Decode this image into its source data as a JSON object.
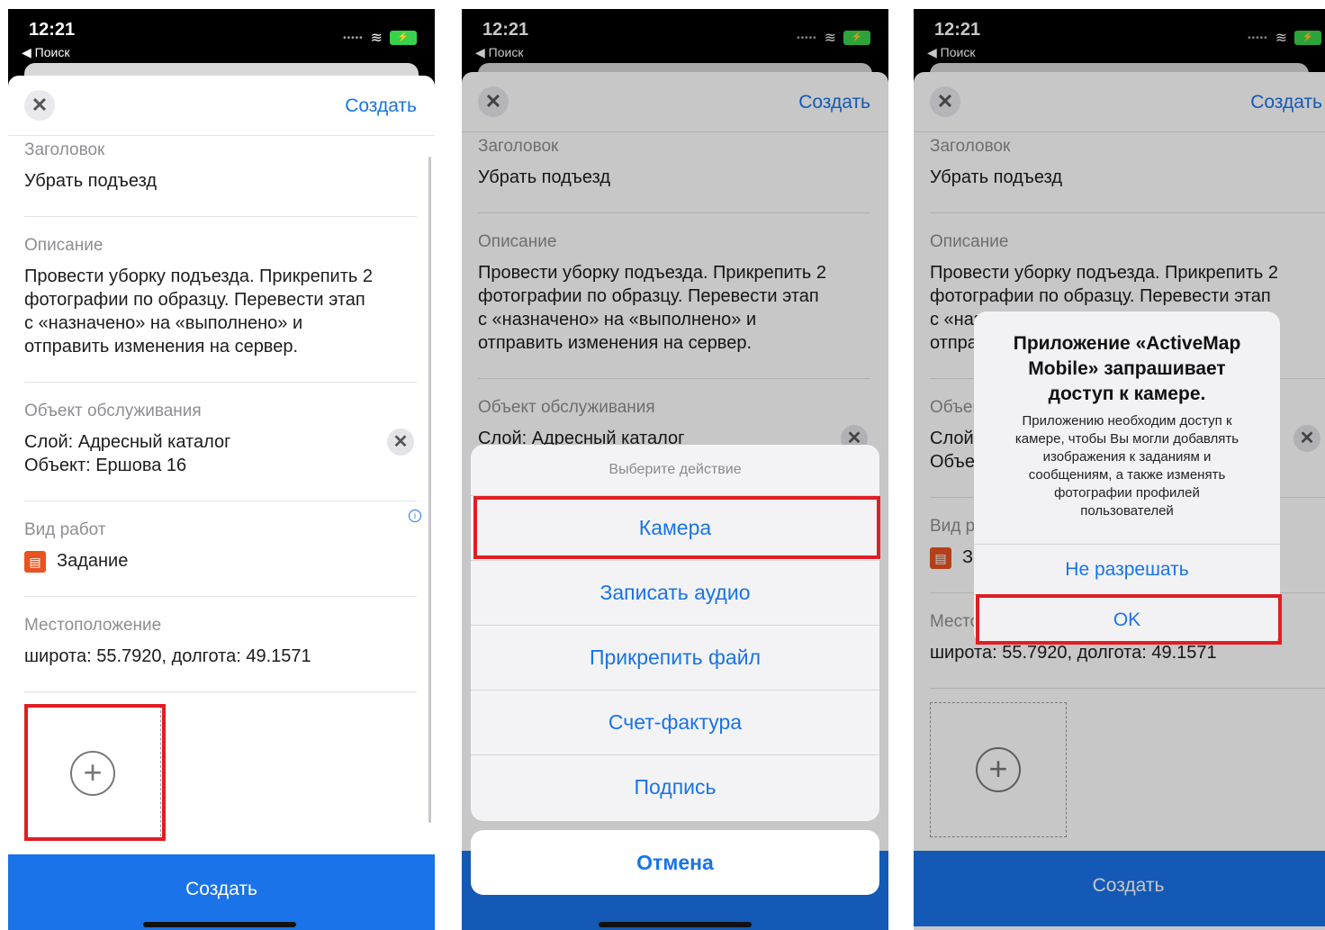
{
  "status": {
    "time": "12:21",
    "back_label": "◀ Поиск"
  },
  "nav": {
    "create_label": "Создать",
    "close_icon": "close-icon"
  },
  "form": {
    "title_label": "Заголовок",
    "title_value": "Убрать подъезд",
    "description_label": "Описание",
    "description_lines": [
      "Провести уборку подъезда. Прикрепить 2",
      "фотографии по образцу. Перевести этап",
      "с «назначено» на «выполнено» и",
      "отправить изменения на сервер."
    ],
    "object_label": "Объект обслуживания",
    "object_layer": "Слой: Адресный каталог",
    "object_name": "Объект: Ершова 16",
    "worktype_label": "Вид работ",
    "worktype_value": "Задание",
    "location_label": "Местоположение",
    "location_value": "широта: 55.7920, долгота: 49.1571"
  },
  "bottom_button": "Создать",
  "action_sheet": {
    "title": "Выберите действие",
    "items": [
      "Камера",
      "Записать аудио",
      "Прикрепить файл",
      "Счет-фактура",
      "Подпись"
    ],
    "cancel": "Отмена"
  },
  "alert": {
    "title_lines": [
      "Приложение «ActiveMap",
      "Mobile» запрашивает",
      "доступ к камере."
    ],
    "message_lines": [
      "Приложению необходим доступ к",
      "камере, чтобы Вы могли добавлять",
      "изображения к заданиям и",
      "сообщениям, а также изменять",
      "фотографии профилей",
      "пользователей"
    ],
    "deny": "Не разрешать",
    "ok": "OK"
  },
  "colors": {
    "accent": "#1a73e8",
    "highlight": "#e01e24",
    "task_icon": "#e8531f"
  }
}
